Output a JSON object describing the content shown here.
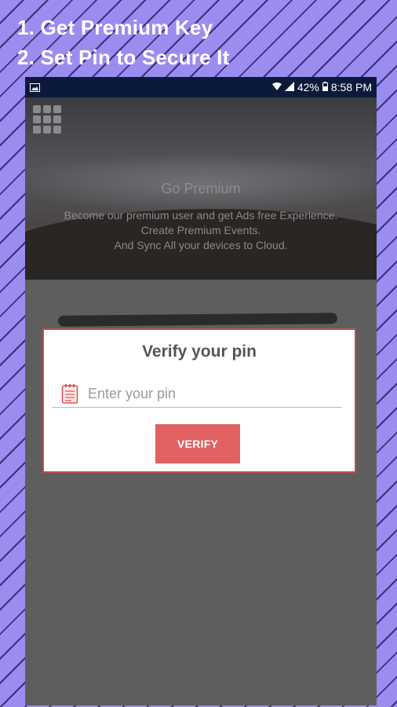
{
  "promo": {
    "line1": "1. Get Premium Key",
    "line2": "2. Set Pin to Secure It"
  },
  "status_bar": {
    "battery": "42%",
    "time": "8:58 PM",
    "icons": [
      "image-icon",
      "wifi-icon",
      "signal-icon",
      "battery-icon"
    ]
  },
  "hero": {
    "title": "Go Premium",
    "line1": "Become our premium user and get Ads free Experience.",
    "line2": "Create Premium Events.",
    "line3": "And Sync All your devices to Cloud."
  },
  "dialog": {
    "title": "Verify your pin",
    "input_placeholder": "Enter your pin",
    "input_value": "",
    "button_label": "VERIFY"
  },
  "colors": {
    "accent": "#e06262",
    "underline": "#7fd3c7",
    "background": "#9b8cf0"
  }
}
